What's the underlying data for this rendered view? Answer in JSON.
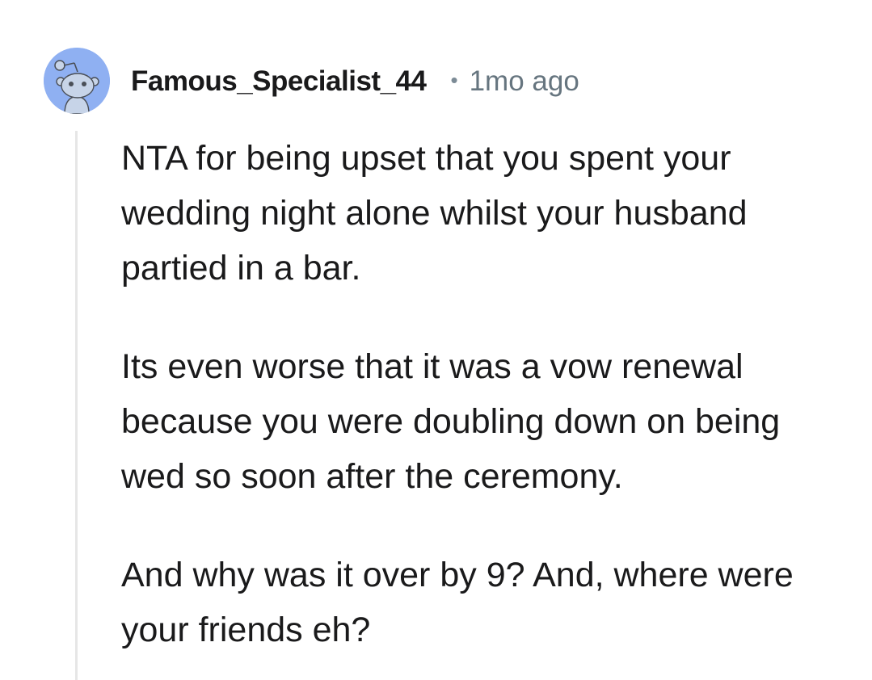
{
  "comment": {
    "username": "Famous_Specialist_44",
    "separator": "•",
    "timestamp": "1mo ago",
    "avatar_icon": "reddit-snoo-avatar-icon",
    "paragraphs": [
      "NTA for being upset that you spent your wedding night alone whilst your husband partied in a bar.",
      "Its even worse that it was a vow renewal because you were doubling down on being wed so soon after the ceremony.",
      "And why was it over by 9? And, where were your friends eh?"
    ]
  },
  "colors": {
    "avatar_bg": "#8fb0f2",
    "snoo_body": "#c7d4e8",
    "text": "#1a1a1b",
    "meta": "#66757f",
    "thread_line": "#e6e6e6"
  }
}
